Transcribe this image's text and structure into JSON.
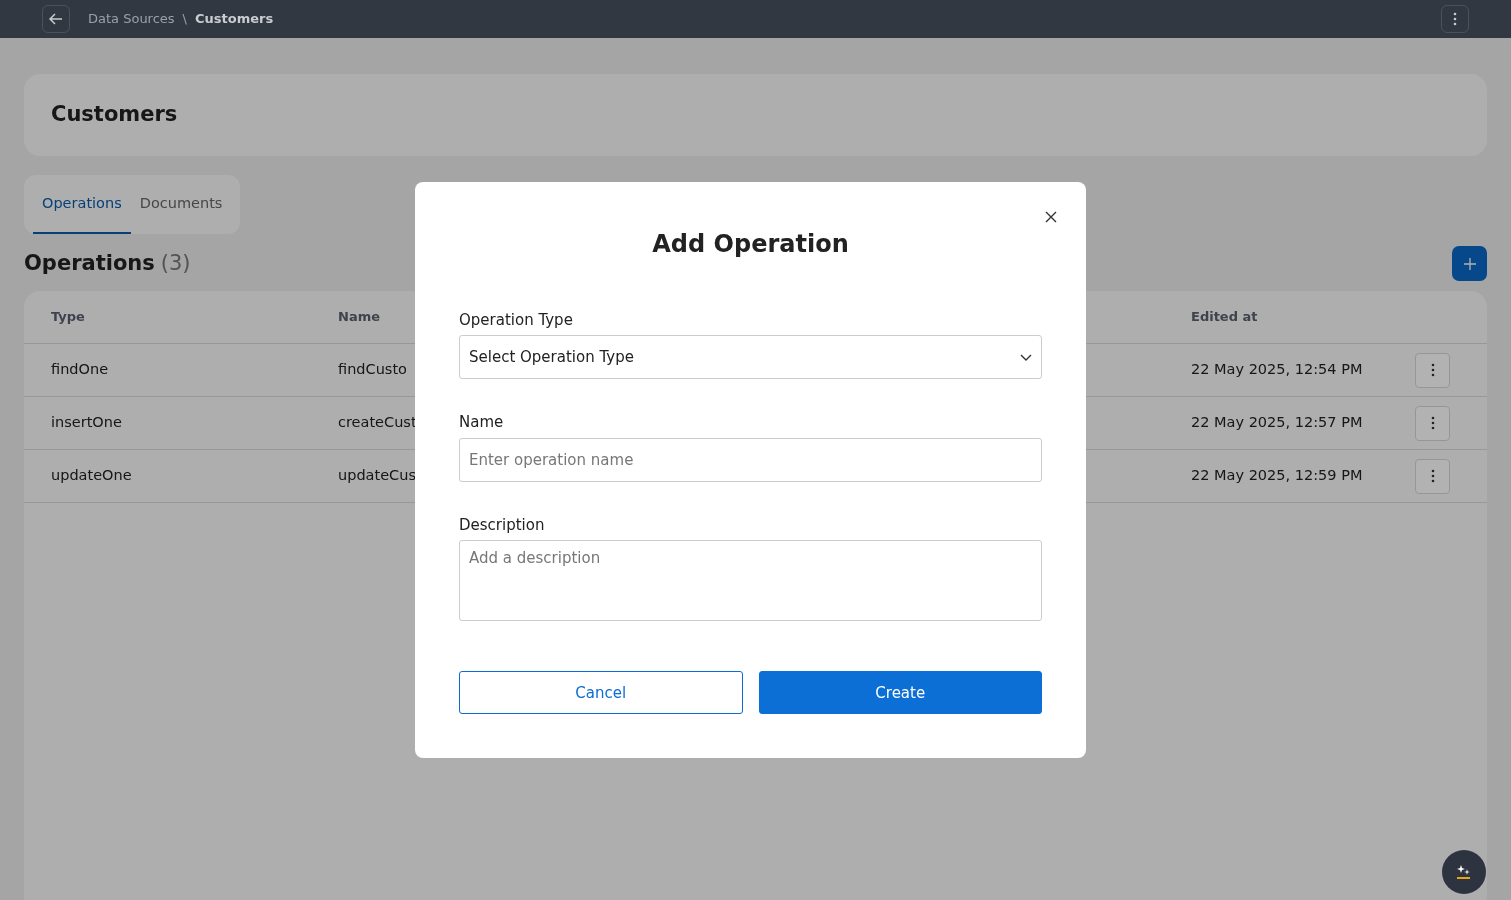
{
  "topbar": {
    "breadcrumb": [
      "Data Sources",
      "Customers"
    ],
    "separator": "\\"
  },
  "header": {
    "title": "Customers"
  },
  "tabs": [
    {
      "label": "Operations",
      "selected": true
    },
    {
      "label": "Documents",
      "selected": false
    }
  ],
  "section": {
    "title": "Operations",
    "count": "(3)"
  },
  "table": {
    "columns": [
      "Type",
      "Name",
      "Edited at"
    ],
    "rows": [
      {
        "type": "findOne",
        "name": "findCusto",
        "edited": "22 May 2025, 12:54 PM"
      },
      {
        "type": "insertOne",
        "name": "createCust",
        "edited": "22 May 2025, 12:57 PM"
      },
      {
        "type": "updateOne",
        "name": "updateCus",
        "edited": "22 May 2025, 12:59 PM"
      }
    ]
  },
  "modal": {
    "title": "Add Operation",
    "fields": [
      {
        "kind": "select",
        "label": "Operation Type",
        "value": "Select Operation Type"
      },
      {
        "kind": "input",
        "label": "Name",
        "placeholder": "Enter operation name"
      },
      {
        "kind": "textarea",
        "label": "Description",
        "placeholder": "Add a description"
      }
    ],
    "buttons": [
      {
        "label": "Cancel",
        "kind": "outline"
      },
      {
        "label": "Create",
        "kind": "primary"
      }
    ]
  }
}
